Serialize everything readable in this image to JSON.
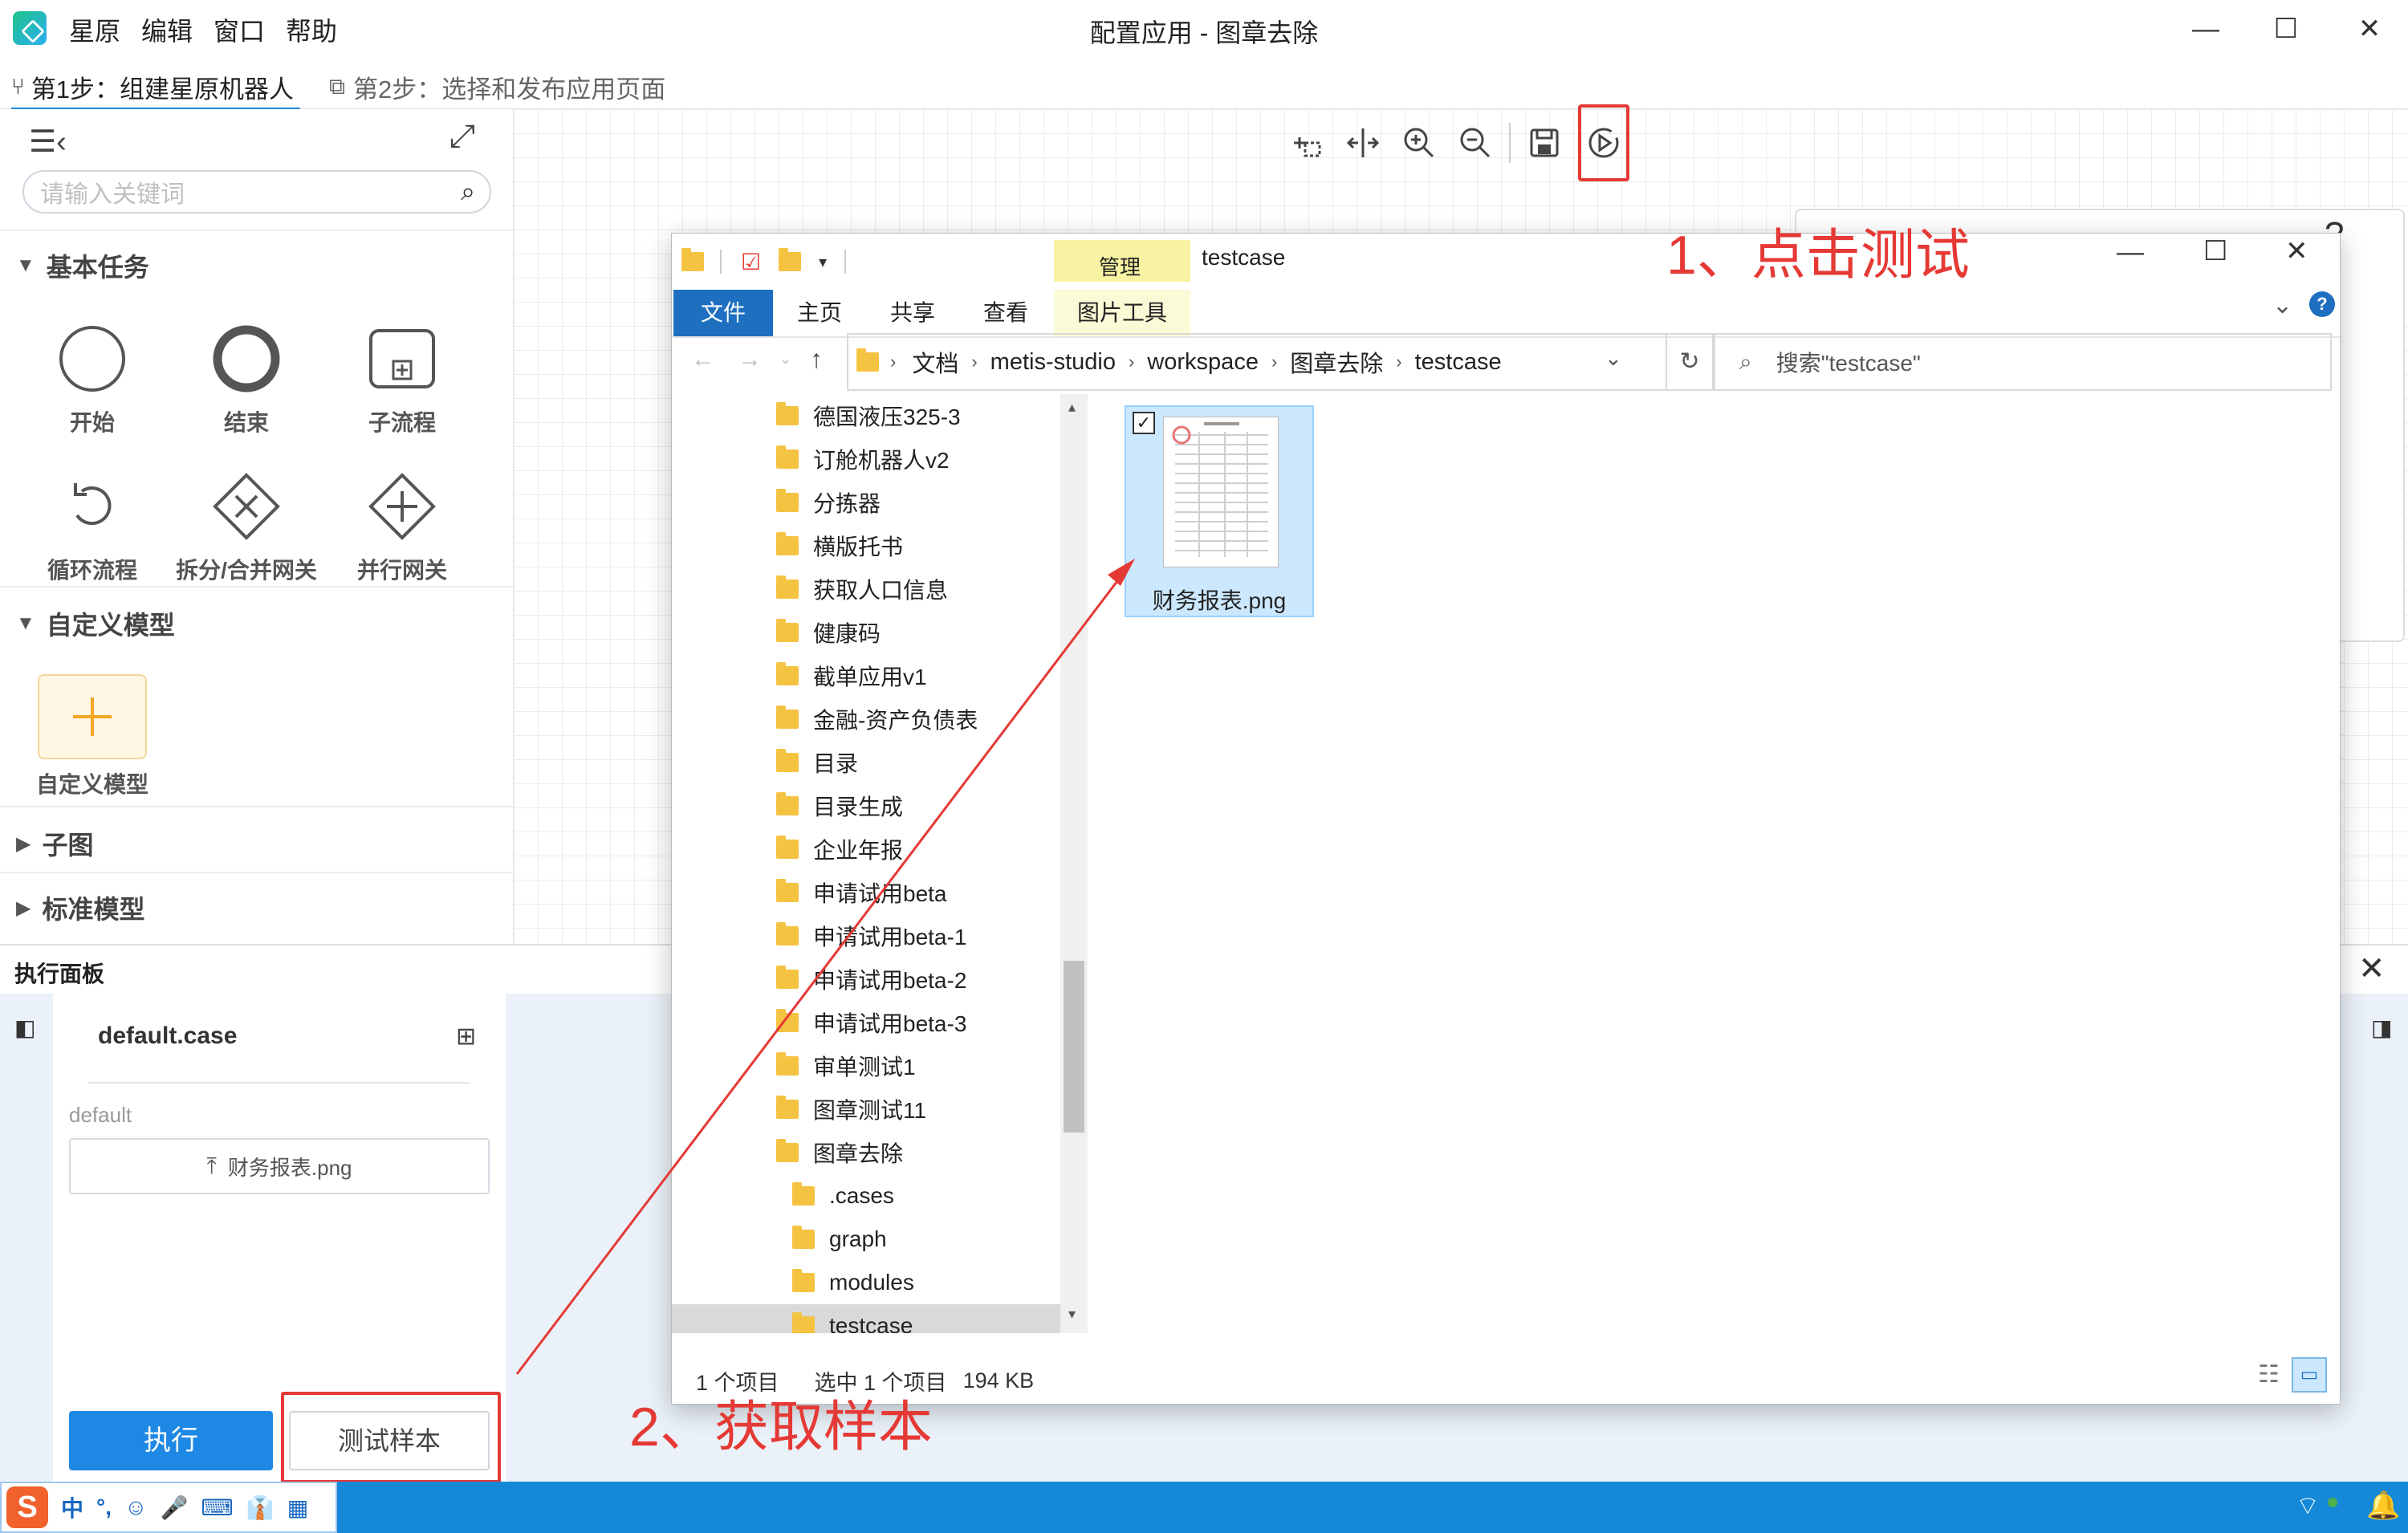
{
  "app": {
    "menu": [
      "星原",
      "编辑",
      "窗口",
      "帮助"
    ],
    "title": "配置应用 - 图章去除",
    "window_controls": {
      "minimize": "—",
      "maximize": "☐",
      "close": "✕"
    }
  },
  "steps": [
    {
      "label": "第1步：组建星原机器人"
    },
    {
      "label": "第2步：选择和发布应用页面"
    }
  ],
  "toolbar": [
    "select-area-icon",
    "split-icon",
    "zoom-in-icon",
    "zoom-out-icon",
    "save-icon",
    "test-run-icon"
  ],
  "left_panel": {
    "search_placeholder": "请输入关键词",
    "sections": {
      "basic": "基本任务",
      "custom": "自定义模型",
      "subgraph": "子图",
      "standard": "标准模型"
    },
    "basic_nodes": [
      "开始",
      "结束",
      "子流程",
      "循环流程",
      "拆分/合并网关",
      "并行网关"
    ],
    "custom_nodes": [
      "自定义模型"
    ]
  },
  "exec_panel": {
    "title": "执行面板",
    "case_name": "default.case",
    "group_label": "default",
    "file_button": "财务报表.png",
    "run_button": "执行",
    "sample_button": "测试样本"
  },
  "explorer": {
    "title": "testcase",
    "ribbon_context": "管理",
    "ribbon_tabs": [
      "文件",
      "主页",
      "共享",
      "查看",
      "图片工具"
    ],
    "breadcrumb": [
      "文档",
      "metis-studio",
      "workspace",
      "图章去除",
      "testcase"
    ],
    "search_placeholder": "搜索\"testcase\"",
    "tree": [
      "德国液压325-3",
      "订舱机器人v2",
      "分拣器",
      "横版托书",
      "获取人口信息",
      "健康码",
      "截单应用v1",
      "金融-资产负债表",
      "目录",
      "目录生成",
      "企业年报",
      "申请试用beta",
      "申请试用beta-1",
      "申请试用beta-2",
      "申请试用beta-3",
      "审单测试1",
      "图章测试11",
      "图章去除"
    ],
    "subtree": [
      ".cases",
      "graph",
      "modules",
      "testcase"
    ],
    "selected_tree_item": "testcase",
    "file": {
      "name": "财务报表.png"
    },
    "status": {
      "count": "1 个项目",
      "selected": "选中 1 个项目",
      "size": "194 KB"
    }
  },
  "annotations": {
    "step1": "1、点击测试",
    "step2": "2、获取样本"
  },
  "taskbar": {
    "ime": [
      "中",
      "°,",
      "☺",
      "🎤",
      "⌨",
      "👔",
      "▦"
    ]
  },
  "colors": {
    "accent": "#1e88e5",
    "annotation": "#e53935",
    "taskbar": "#1589d8",
    "folder": "#f5c342",
    "selection": "#cce8ff"
  }
}
